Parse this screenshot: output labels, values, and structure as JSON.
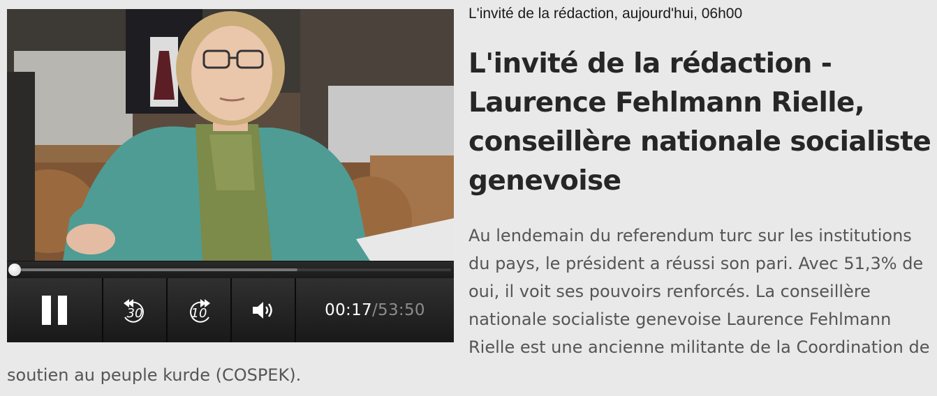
{
  "episode": {
    "meta": "L'invité de la rédaction, aujourd'hui, 06h00",
    "title": "L'invité de la rédaction - Laurence Fehlmann Rielle, conseillère nationale socialiste genevoise",
    "description": "Au lendemain du referendum turc sur les institutions du pays, le président a réussi son pari. Avec 51,3% de oui, il voit ses pouvoirs renforcés. La conseillère nationale socialiste genevoise Laurence Fehlmann Rielle est une ancienne militante de la Coordination de soutien au peuple kurde (COSPEK)."
  },
  "player": {
    "skip_back_label": "30",
    "skip_forward_label": "10",
    "time_current": "00:17",
    "time_separator": " / ",
    "time_total": "53:50",
    "progress_fraction": 0.005,
    "buffered_fraction": 0.65,
    "icons": {
      "play_state": "pause-icon",
      "skip_back": "rewind-30-icon",
      "skip_forward": "forward-10-icon",
      "volume": "volume-icon"
    }
  }
}
